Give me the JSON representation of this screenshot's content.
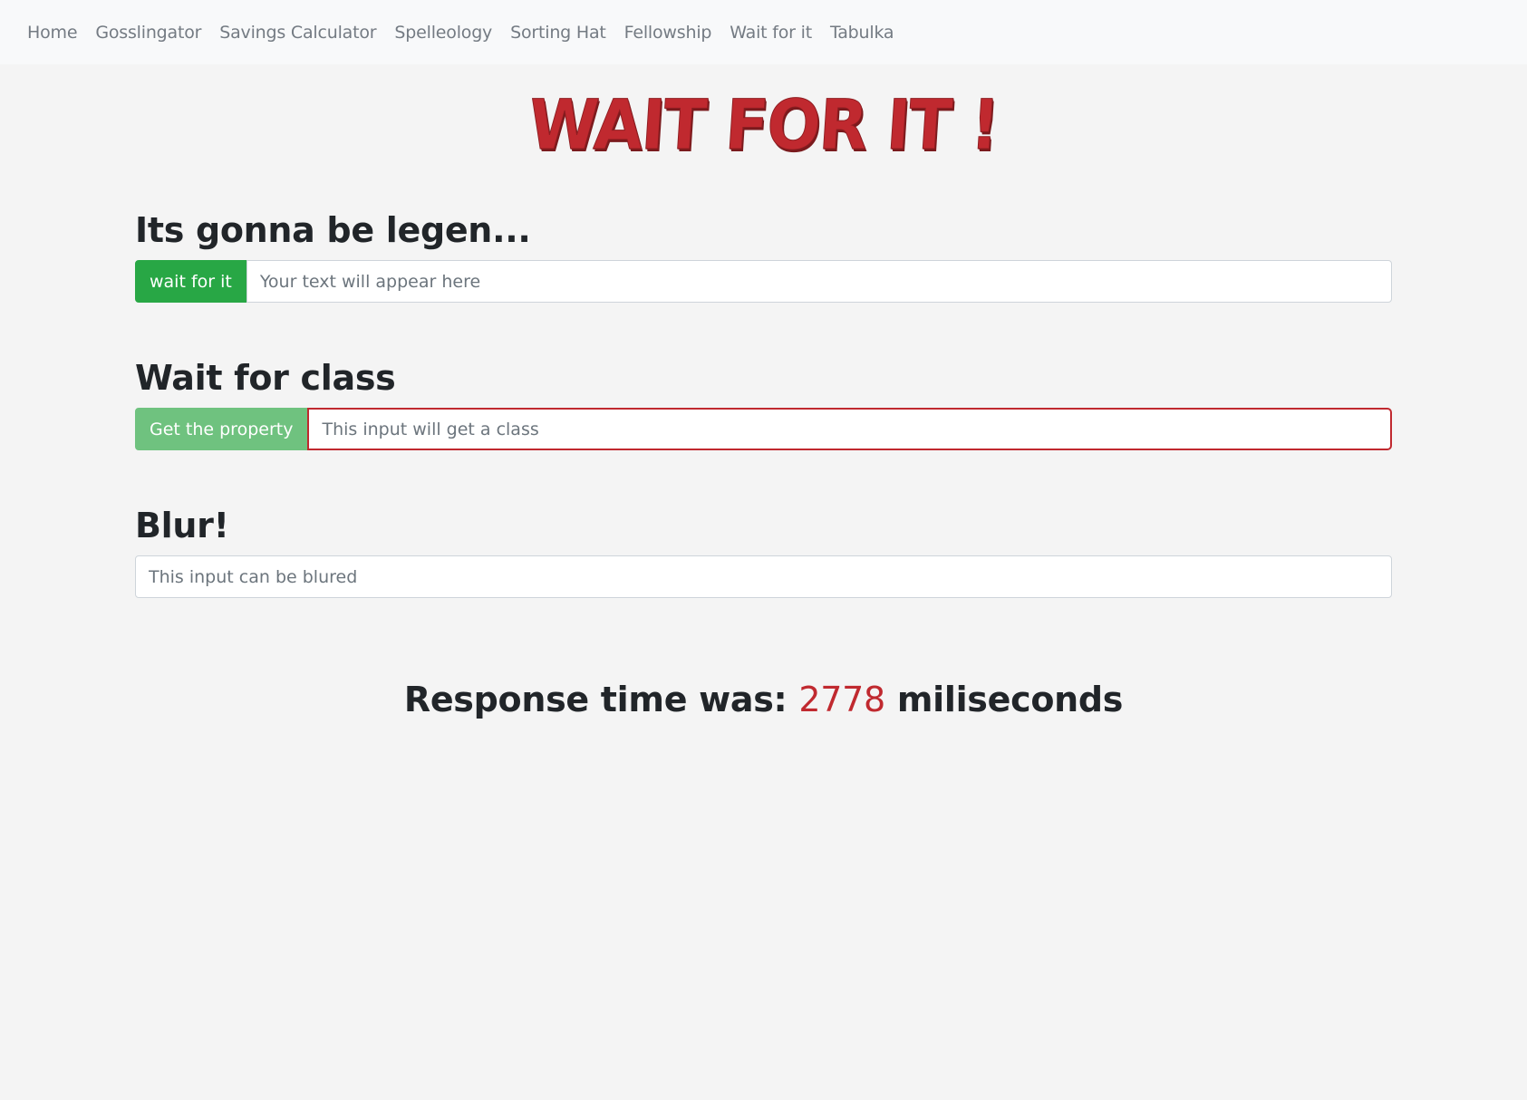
{
  "nav": {
    "items": [
      "Home",
      "Gosslingator",
      "Savings Calculator",
      "Spelleology",
      "Sorting Hat",
      "Fellowship",
      "Wait for it",
      "Tabulka"
    ]
  },
  "header": {
    "title": "WAIT FOR IT !"
  },
  "sections": {
    "legen": {
      "heading": "Its gonna be legen...",
      "button_label": "wait for it",
      "input_placeholder": "Your text will appear here",
      "input_value": ""
    },
    "wait_class": {
      "heading": "Wait for class",
      "button_label": "Get the property",
      "input_placeholder": "This input will get a class",
      "input_value": ""
    },
    "blur": {
      "heading": "Blur!",
      "input_placeholder": "This input can be blured",
      "input_value": ""
    }
  },
  "response": {
    "prefix": "Response time was: ",
    "value": "2778",
    "suffix": " miliseconds"
  },
  "colors": {
    "accent_red": "#c0292f",
    "button_green": "#28a745",
    "button_green_faded": "#6fc27f",
    "navbar_bg": "#f8f9fa",
    "page_bg": "#f4f4f4"
  }
}
